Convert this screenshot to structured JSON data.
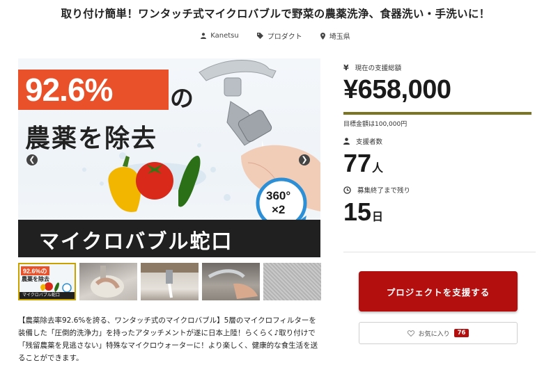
{
  "project": {
    "title": "取り付け簡単！ワンタッチ式マイクロバブルで野菜の農薬洗浄、食器洗い・手洗いに！",
    "meta": {
      "author": "Kanetsu",
      "category": "プロダクト",
      "location": "埼玉県"
    }
  },
  "hero": {
    "badge": "92.6%",
    "badge_suffix": "の",
    "headline": "農薬を除去",
    "banner": "マイクロバブル蛇口",
    "rotation_top": "360°",
    "rotation_bottom": "×2",
    "prev_icon": "chevron-left-icon",
    "next_icon": "chevron-right-icon"
  },
  "thumbnails": [
    {
      "label": "92.6%の農薬を除去",
      "banner": "マイクロバブル蛇口",
      "active": true
    },
    {
      "label": "",
      "active": false
    },
    {
      "label": "",
      "active": false
    },
    {
      "label": "",
      "active": false
    },
    {
      "label": "",
      "active": false
    }
  ],
  "description": "【農薬除去率92.6%を誇る、ワンタッチ式のマイクロバブル】5層のマイクロフィルターを装備した「圧倒的洗浄力」を持ったアタッチメントが遂に日本上陸！らくらく♪取り付けで「残留農薬を見逃さない」特殊なマイクロウォーターに！より楽しく、健康的な食生活を送ることができます。",
  "stats": {
    "raised_label": "現在の支援総額",
    "raised_amount": "¥658,000",
    "progress_percent": 658,
    "goal_text": "目標金額は100,000円",
    "backers_label": "支援者数",
    "backers_count": "77",
    "backers_unit": "人",
    "remaining_label": "募集終了まで残り",
    "remaining_count": "15",
    "remaining_unit": "日"
  },
  "actions": {
    "support_label": "プロジェクトを支援する",
    "favorite_label": "お気に入り",
    "favorite_count": "76"
  },
  "colors": {
    "accent": "#b40f0f",
    "progress": "#7b7521",
    "badge": "#e8512a",
    "active_thumb_border": "#c9a200"
  }
}
